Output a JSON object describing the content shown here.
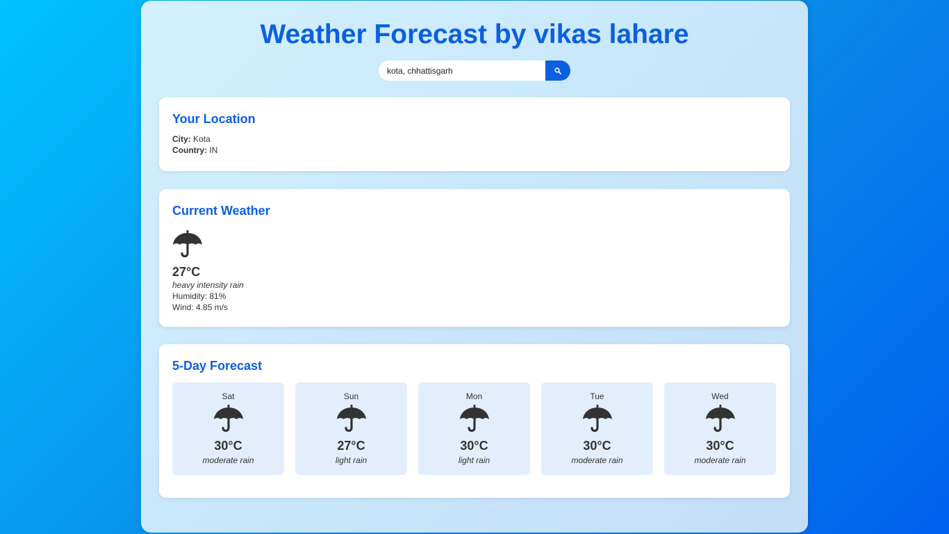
{
  "header": {
    "title": "Weather Forecast by vikas lahare"
  },
  "search": {
    "value": "kota, chhattisgarh",
    "button_icon": "search-icon"
  },
  "location": {
    "heading": "Your Location",
    "city_label": "City:",
    "city": "Kota",
    "country_label": "Country:",
    "country": "IN"
  },
  "current": {
    "heading": "Current Weather",
    "icon": "umbrella-icon",
    "temperature": "27°C",
    "description": "heavy intensity rain",
    "humidity": "Humidity: 81%",
    "wind": "Wind: 4.85 m/s"
  },
  "forecast": {
    "heading": "5-Day Forecast",
    "days": [
      {
        "day": "Sat",
        "icon": "umbrella-icon",
        "temp": "30°C",
        "desc": "moderate rain"
      },
      {
        "day": "Sun",
        "icon": "umbrella-icon",
        "temp": "27°C",
        "desc": "light rain"
      },
      {
        "day": "Mon",
        "icon": "umbrella-icon",
        "temp": "30°C",
        "desc": "light rain"
      },
      {
        "day": "Tue",
        "icon": "umbrella-icon",
        "temp": "30°C",
        "desc": "moderate rain"
      },
      {
        "day": "Wed",
        "icon": "umbrella-icon",
        "temp": "30°C",
        "desc": "moderate rain"
      }
    ]
  },
  "colors": {
    "accent": "#0c5fe0",
    "card_bg": "#ffffff",
    "forecast_tile_bg": "#e3eefc",
    "text": "#333333"
  }
}
